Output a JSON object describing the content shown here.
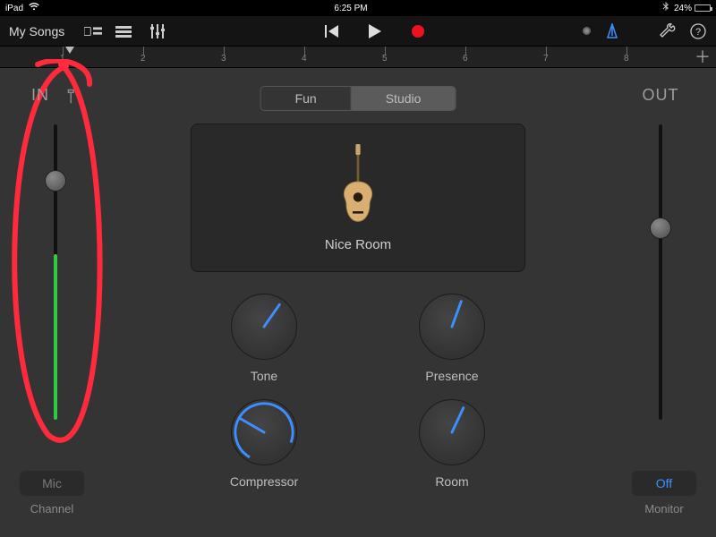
{
  "status": {
    "device": "iPad",
    "time": "6:25 PM",
    "battery_text": "24%",
    "battery_pct": 24
  },
  "toolbar": {
    "my_songs": "My Songs"
  },
  "ruler": {
    "marks": [
      "1",
      "2",
      "3",
      "4",
      "5",
      "6",
      "7",
      "8"
    ]
  },
  "in": {
    "label": "IN",
    "level_pct": 56,
    "knob_pos_pct": 19
  },
  "out": {
    "label": "OUT",
    "knob_pos_pct": 35
  },
  "segmented": {
    "fun": "Fun",
    "studio": "Studio",
    "active": "studio"
  },
  "preset": {
    "name": "Nice Room"
  },
  "knobs": {
    "tone": {
      "label": "Tone",
      "angle": 35
    },
    "presence": {
      "label": "Presence",
      "angle": 20
    },
    "compressor": {
      "label": "Compressor",
      "angle": 300
    },
    "room": {
      "label": "Room",
      "angle": 25
    }
  },
  "bottom": {
    "mic": {
      "button": "Mic",
      "label": "Channel"
    },
    "monitor": {
      "button": "Off",
      "label": "Monitor"
    }
  }
}
